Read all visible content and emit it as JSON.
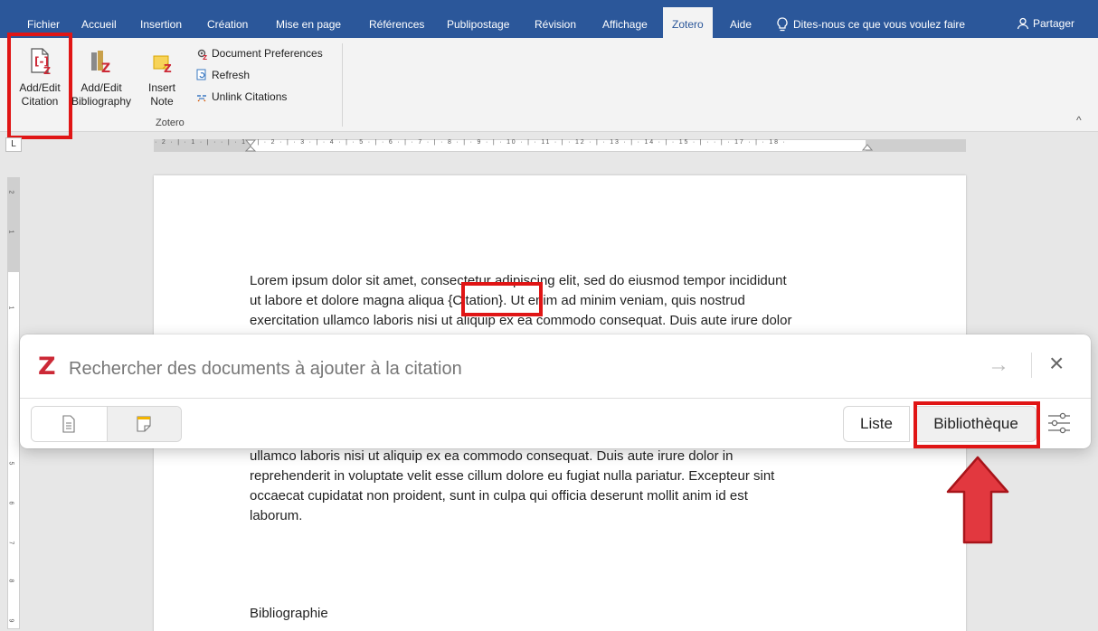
{
  "ribbon_tabs": {
    "fichier": "Fichier",
    "accueil": "Accueil",
    "insertion": "Insertion",
    "creation": "Création",
    "mise_en_page": "Mise en page",
    "references": "Références",
    "publipostage": "Publipostage",
    "revision": "Révision",
    "affichage": "Affichage",
    "zotero": "Zotero",
    "aide": "Aide"
  },
  "tell_me": "Dites-nous ce que vous voulez faire",
  "share_label": "Partager",
  "zotero_group": {
    "add_edit_citation": [
      "Add/Edit",
      "Citation"
    ],
    "add_edit_bibliography": [
      "Add/Edit",
      "Bibliography"
    ],
    "insert_note": [
      "Insert",
      "Note"
    ],
    "document_preferences": "Document Preferences",
    "refresh": "Refresh",
    "unlink_citations": "Unlink Citations",
    "group_label": "Zotero"
  },
  "ruler": {
    "corner": "L",
    "horizontal_text": "· 2 · | · 1 · | ·  ·  | · 1 · | · 2 · | · 3 · | · 4 · | · 5 · | · 6 · | · 7 · | · 8 · | · 9 · | · 10 · | · 11 · | · 12 · | · 13 · | · 14 · | · 15 · | ·   · | · 17 · | · 18 ·",
    "vertical_numbers": [
      "2",
      "1",
      "1",
      "5",
      "6",
      "7",
      "8",
      "9"
    ]
  },
  "document": {
    "para1_line1": "Lorem ipsum dolor sit amet, consectetur adipiscing elit, sed do eiusmod tempor incididunt",
    "para1_line2": "ut labore et dolore magna aliqua {Citation}. Ut enim ad minim veniam, quis nostrud",
    "para1_line3": "exercitation ullamco laboris nisi ut aliquip ex ea commodo consequat. Duis aute irure dolor",
    "para2_line1": "ullamco laboris nisi ut aliquip ex ea commodo consequat. Duis aute irure dolor in",
    "para2_line2": "reprehenderit in voluptate velit esse cillum dolore eu fugiat nulla pariatur. Excepteur sint",
    "para2_line3": "occaecat cupidatat non proident, sunt in culpa qui officia deserunt mollit anim id est",
    "para2_line4": "laborum.",
    "bibliography_heading": "Bibliographie"
  },
  "zotero_dialog": {
    "logo": "Z",
    "search_placeholder": "Rechercher des documents à ajouter à la citation",
    "arrow": "→",
    "close": "×",
    "list_button": "Liste",
    "library_button": "Bibliothèque"
  },
  "colors": {
    "ribbon_blue": "#2b579a",
    "highlight_red": "#e01515",
    "zotero_red": "#cc2936",
    "arrow_red": "#e2383f"
  }
}
